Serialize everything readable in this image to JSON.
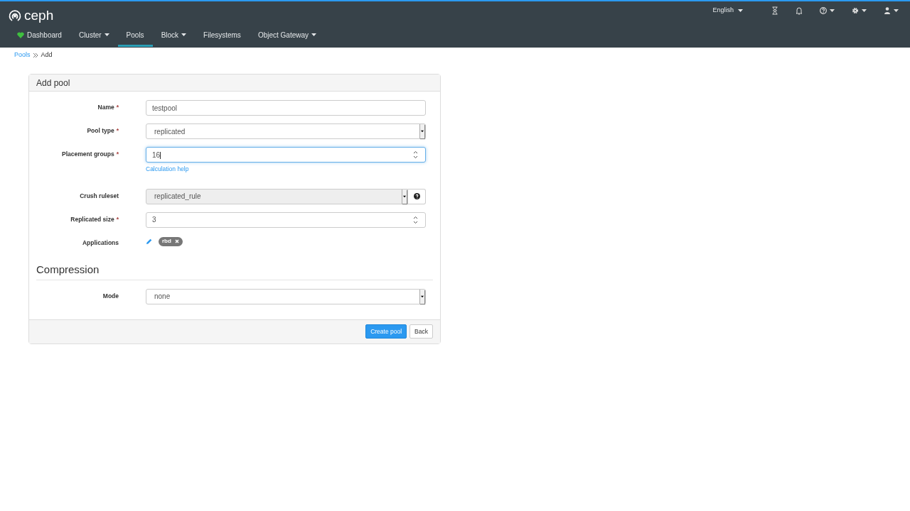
{
  "brand": {
    "name": "ceph"
  },
  "nav": [
    {
      "label": "Dashboard",
      "selected": false,
      "dropdown": false,
      "kind": "health"
    },
    {
      "label": "Cluster",
      "selected": false,
      "dropdown": true
    },
    {
      "label": "Pools",
      "selected": true,
      "dropdown": false
    },
    {
      "label": "Block",
      "selected": false,
      "dropdown": true
    },
    {
      "label": "Filesystems",
      "selected": false,
      "dropdown": false
    },
    {
      "label": "Object Gateway",
      "selected": false,
      "dropdown": true
    }
  ],
  "language": {
    "label": "English"
  },
  "toolbar": [
    {
      "kind": "hourglass",
      "dropdown": false
    },
    {
      "kind": "bell",
      "dropdown": false
    },
    {
      "kind": "help",
      "dropdown": true
    },
    {
      "kind": "gear",
      "dropdown": true
    },
    {
      "kind": "user",
      "dropdown": true
    }
  ],
  "breadcrumb": [
    {
      "label": "Pools",
      "link": true
    },
    {
      "label": "Add",
      "link": false
    }
  ],
  "form": {
    "title": "Add pool",
    "fields": [
      {
        "kind": "text",
        "label": "Name",
        "required_mark": "*",
        "value": "testpool",
        "focused": false,
        "disabled": false
      },
      {
        "kind": "select",
        "label": "Pool type",
        "required_mark": "*",
        "value": "replicated",
        "focused": false,
        "disabled": false
      },
      {
        "kind": "number",
        "label": "Placement groups",
        "required_mark": "*",
        "value": "16",
        "focused": true,
        "disabled": false,
        "help_link": "Calculation help"
      },
      {
        "kind": "select",
        "label": "Crush ruleset",
        "value": "replicated_rule",
        "focused": false,
        "disabled": true,
        "info_button": true
      },
      {
        "kind": "number",
        "label": "Replicated size",
        "required_mark": "*",
        "value": "3",
        "focused": false,
        "disabled": false
      },
      {
        "kind": "tags",
        "label": "Applications",
        "tags": [
          "rbd"
        ]
      }
    ],
    "section": {
      "title": "Compression",
      "fields": [
        {
          "kind": "select",
          "label": "Mode",
          "value": "none",
          "focused": false,
          "disabled": false
        }
      ]
    },
    "buttons": [
      {
        "label": "Create pool",
        "kind": "primary"
      },
      {
        "label": "Back",
        "kind": "default"
      }
    ]
  }
}
